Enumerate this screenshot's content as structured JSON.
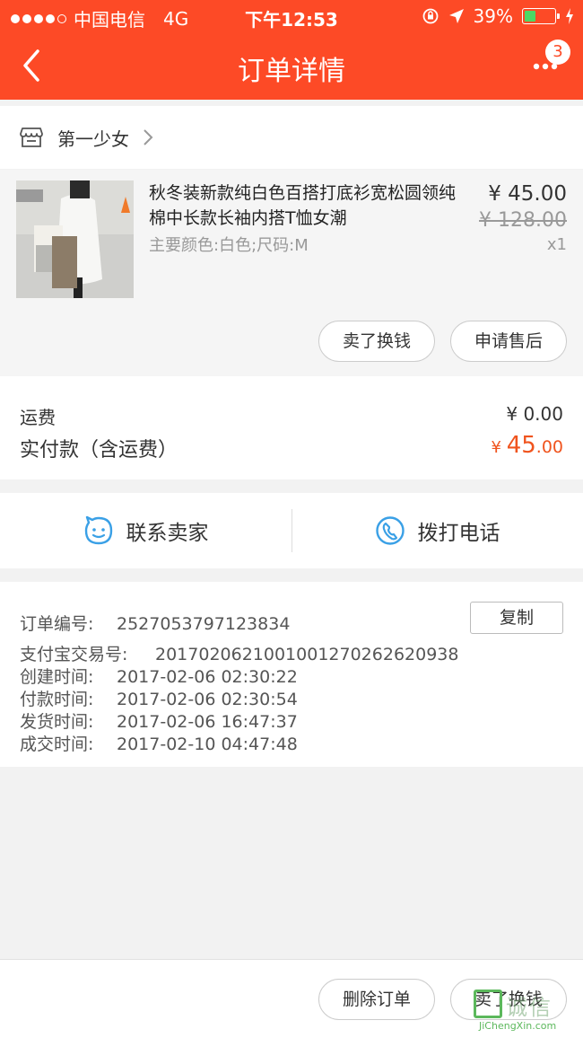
{
  "status_bar": {
    "carrier": "中国电信",
    "network": "4G",
    "time": "下午12:53",
    "battery_text": "39%",
    "battery_level": 0.39
  },
  "nav": {
    "title": "订单详情",
    "notification_count": "3"
  },
  "shop": {
    "name": "第一少女"
  },
  "product": {
    "title": "秋冬装新款纯白色百搭打底衫宽松圆领纯棉中长款长袖内搭T恤女潮",
    "spec": "主要颜色:白色;尺码:M",
    "price": "¥ 45.00",
    "original_price": "¥ 128.00",
    "quantity": "x1",
    "buttons": {
      "sell": "卖了换钱",
      "after_sale": "申请售后"
    }
  },
  "fees": {
    "shipping_label": "运费",
    "shipping_value": "¥ 0.00",
    "paid_label": "实付款（含运费）",
    "paid_currency": "¥ ",
    "paid_integer": "45",
    "paid_decimal": ".00"
  },
  "contact": {
    "seller": "联系卖家",
    "phone": "拨打电话"
  },
  "order_info": {
    "order_no_label": "订单编号:",
    "order_no": "2527053797123834",
    "copy": "复制",
    "alipay_label": "支付宝交易号:",
    "alipay_no": "2017020621001001270262620938",
    "created_label": "创建时间:",
    "created": "2017-02-06 02:30:22",
    "paid_label": "付款时间:",
    "paid": "2017-02-06 02:30:54",
    "shipped_label": "发货时间:",
    "shipped": "2017-02-06 16:47:37",
    "completed_label": "成交时间:",
    "completed": "2017-02-10 04:47:48"
  },
  "bottom": {
    "delete": "删除订单",
    "sell": "卖了换钱"
  },
  "watermark": {
    "text": "诚信",
    "sub": "JiChengXin.com"
  },
  "colors": {
    "brand": "#fd4a26",
    "price_accent": "#f0541e",
    "icon_blue": "#3aa0e6"
  },
  "icons": [
    "back-arrow-icon",
    "more-icon",
    "shop-icon",
    "chevron-right-icon",
    "chat-face-icon",
    "phone-icon"
  ]
}
